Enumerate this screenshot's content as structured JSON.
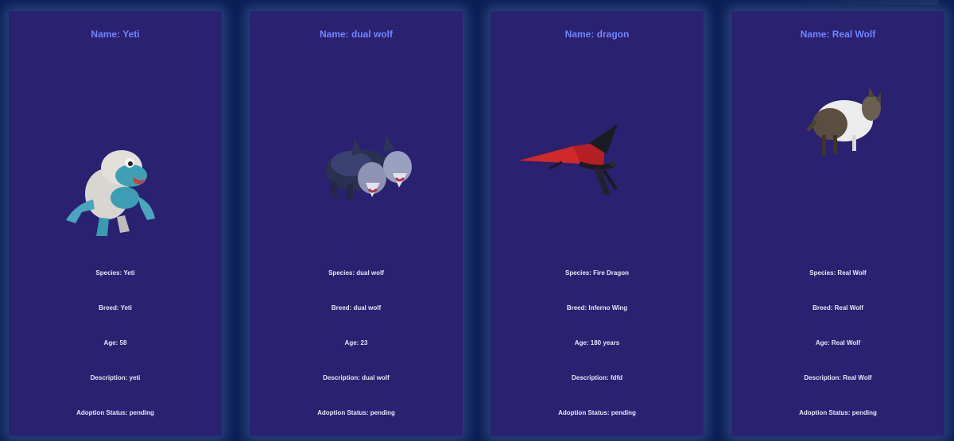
{
  "pets": [
    {
      "name": "Name: Yeti",
      "species": "Species: Yeti",
      "breed": "Breed: Yeti",
      "age": "Age: 58",
      "description": "Description: yeti",
      "status": "Adoption Status: pending",
      "model_icon": "yeti-model"
    },
    {
      "name": "Name: dual wolf",
      "species": "Species: dual wolf",
      "breed": "Breed: dual wolf",
      "age": "Age: 23",
      "description": "Description: dual wolf",
      "status": "Adoption Status: pending",
      "model_icon": "two-headed-wolf-model"
    },
    {
      "name": "Name: dragon",
      "species": "Species: Fire Dragon",
      "breed": "Breed: Inferno Wing",
      "age": "Age: 180 years",
      "description": "Description: fdfd",
      "status": "Adoption Status: pending",
      "model_icon": "dragon-model"
    },
    {
      "name": "Name: Real Wolf",
      "species": "Species: Real Wolf",
      "breed": "Breed: Real Wolf",
      "age": "Age: Real Wolf",
      "description": "Description: Real Wolf",
      "status": "Adoption Status: pending",
      "model_icon": "wolf-model"
    }
  ],
  "colors": {
    "page_background": "#0b1f55",
    "card_background": "#2a2171",
    "title_text": "#6f86ff",
    "field_text": "#e7e6f5"
  }
}
